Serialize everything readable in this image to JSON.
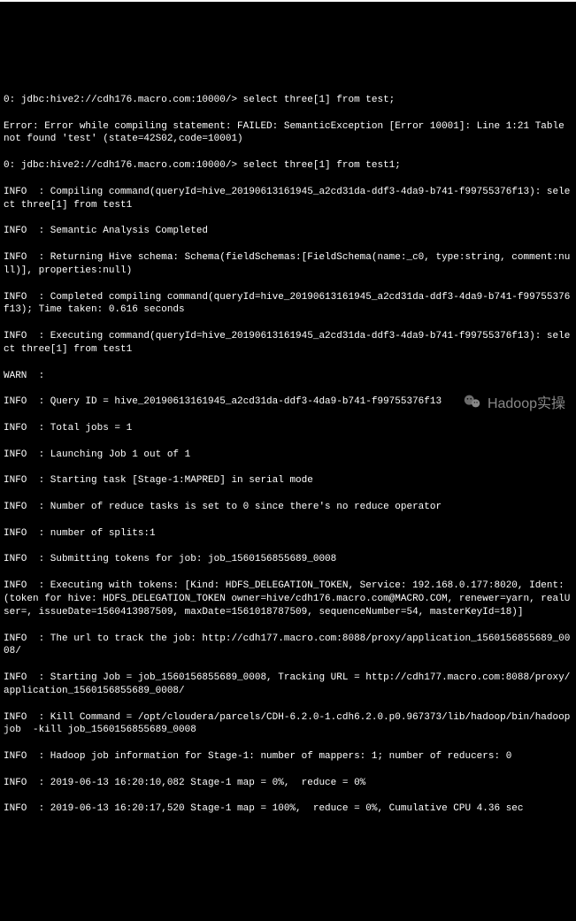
{
  "terminal": {
    "lines": [
      "0: jdbc:hive2://cdh176.macro.com:10000/> select three[1] from test;",
      "Error: Error while compiling statement: FAILED: SemanticException [Error 10001]: Line 1:21 Table not found 'test' (state=42S02,code=10001)",
      "0: jdbc:hive2://cdh176.macro.com:10000/> select three[1] from test1;",
      "INFO  : Compiling command(queryId=hive_20190613161945_a2cd31da-ddf3-4da9-b741-f99755376f13): select three[1] from test1",
      "INFO  : Semantic Analysis Completed",
      "INFO  : Returning Hive schema: Schema(fieldSchemas:[FieldSchema(name:_c0, type:string, comment:null)], properties:null)",
      "INFO  : Completed compiling command(queryId=hive_20190613161945_a2cd31da-ddf3-4da9-b741-f99755376f13); Time taken: 0.616 seconds",
      "INFO  : Executing command(queryId=hive_20190613161945_a2cd31da-ddf3-4da9-b741-f99755376f13): select three[1] from test1",
      "WARN  :",
      "INFO  : Query ID = hive_20190613161945_a2cd31da-ddf3-4da9-b741-f99755376f13",
      "INFO  : Total jobs = 1",
      "INFO  : Launching Job 1 out of 1",
      "INFO  : Starting task [Stage-1:MAPRED] in serial mode",
      "INFO  : Number of reduce tasks is set to 0 since there's no reduce operator",
      "INFO  : number of splits:1",
      "INFO  : Submitting tokens for job: job_1560156855689_0008",
      "INFO  : Executing with tokens: [Kind: HDFS_DELEGATION_TOKEN, Service: 192.168.0.177:8020, Ident: (token for hive: HDFS_DELEGATION_TOKEN owner=hive/cdh176.macro.com@MACRO.COM, renewer=yarn, realUser=, issueDate=1560413987509, maxDate=1561018787509, sequenceNumber=54, masterKeyId=18)]",
      "INFO  : The url to track the job: http://cdh177.macro.com:8088/proxy/application_1560156855689_0008/",
      "INFO  : Starting Job = job_1560156855689_0008, Tracking URL = http://cdh177.macro.com:8088/proxy/application_1560156855689_0008/",
      "INFO  : Kill Command = /opt/cloudera/parcels/CDH-6.2.0-1.cdh6.2.0.p0.967373/lib/hadoop/bin/hadoop job  -kill job_1560156855689_0008",
      "INFO  : Hadoop job information for Stage-1: number of mappers: 1; number of reducers: 0",
      "INFO  : 2019-06-13 16:20:10,082 Stage-1 map = 0%,  reduce = 0%",
      "INFO  : 2019-06-13 16:20:17,520 Stage-1 map = 100%,  reduce = 0%, Cumulative CPU 4.36 sec"
    ]
  },
  "watermark": {
    "text": "Hadoop实操"
  }
}
